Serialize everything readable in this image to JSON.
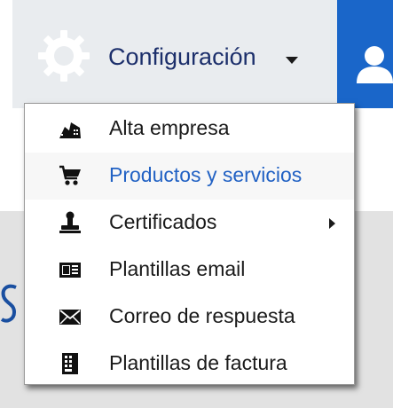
{
  "nav": {
    "config_label": "Configuración",
    "icons": {
      "settings": "gear-icon",
      "dropdown": "chevron-down-icon",
      "user": "user-icon"
    },
    "colors": {
      "bar_blue": "#1a66c9",
      "tab_bg": "#e9ecef",
      "label_text": "#1c2f6b"
    }
  },
  "menu": {
    "items": [
      {
        "label": "Alta empresa",
        "icon": "companies-icon"
      },
      {
        "label": "Productos y servicios",
        "icon": "shopping-cart-icon",
        "highlighted": true
      },
      {
        "label": "Certificados",
        "icon": "stamp-icon",
        "has_submenu": true
      },
      {
        "label": "Plantillas email",
        "icon": "email-template-icon"
      },
      {
        "label": "Correo de respuesta",
        "icon": "envelope-icon"
      },
      {
        "label": "Plantillas de factura",
        "icon": "invoice-template-icon"
      }
    ],
    "colors": {
      "highlight_text": "#2262c4",
      "text": "#1a1a1a"
    }
  }
}
